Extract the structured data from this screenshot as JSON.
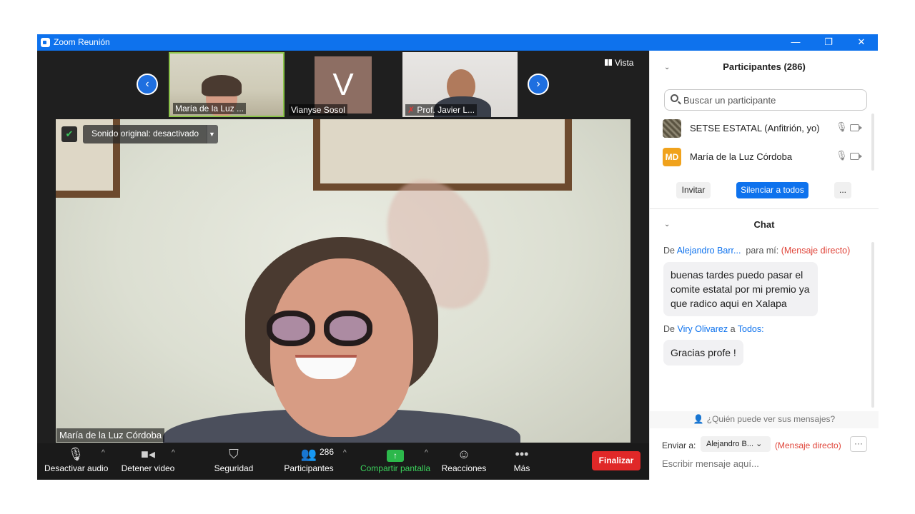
{
  "window": {
    "title": "Zoom Reunión",
    "controls": [
      "—",
      "❐",
      "✕"
    ]
  },
  "thumbnails": [
    {
      "name": "María de la Luz ..."
    },
    {
      "name": "Vianyse Sosol",
      "initial": "V",
      "avatar_color": "#8d6e63"
    },
    {
      "name": "Prof. Javier L..."
    }
  ],
  "view_button": "Vista",
  "main_video": {
    "sound_label": "Sonido original: desactivado",
    "participant_name": "María de la Luz Córdoba"
  },
  "toolbar": {
    "audio": "Desactivar audio",
    "video": "Detener video",
    "security": "Seguridad",
    "participants": "Participantes",
    "participants_count": "286",
    "share": "Compartir pantalla",
    "reactions": "Reacciones",
    "more": "Más",
    "end": "Finalizar"
  },
  "participants_panel": {
    "title": "Participantes (286)",
    "search_placeholder": "Buscar un participante",
    "list": [
      {
        "name": "SETSE ESTATAL (Anfitrión, yo)"
      },
      {
        "name": "María de la Luz Córdoba",
        "initials": "MD",
        "avatar_color": "#f0a21c"
      }
    ],
    "invite": "Invitar",
    "mute_all": "Silenciar a todos",
    "more": "..."
  },
  "chat": {
    "title": "Chat",
    "messages": [
      {
        "from_prefix": "De",
        "from": "Alejandro Barr...",
        "to": "para mí:",
        "tag": "(Mensaje directo)",
        "text": "buenas tardes puedo pasar el comite estatal por mi premio ya que radico aqui en Xalapa"
      },
      {
        "from_prefix": "De",
        "from": "Viry Olivarez",
        "to_prefix": "a",
        "to": "Todos:",
        "text": "Gracias profe !"
      }
    ],
    "who_can_see": "¿Quién puede ver sus mensajes?",
    "send_to_label": "Enviar a:",
    "send_to_value": "Alejandro B...",
    "send_to_tag": "(Mensaje directo)",
    "more": "···",
    "input_placeholder": "Escribir mensaje aquí..."
  }
}
